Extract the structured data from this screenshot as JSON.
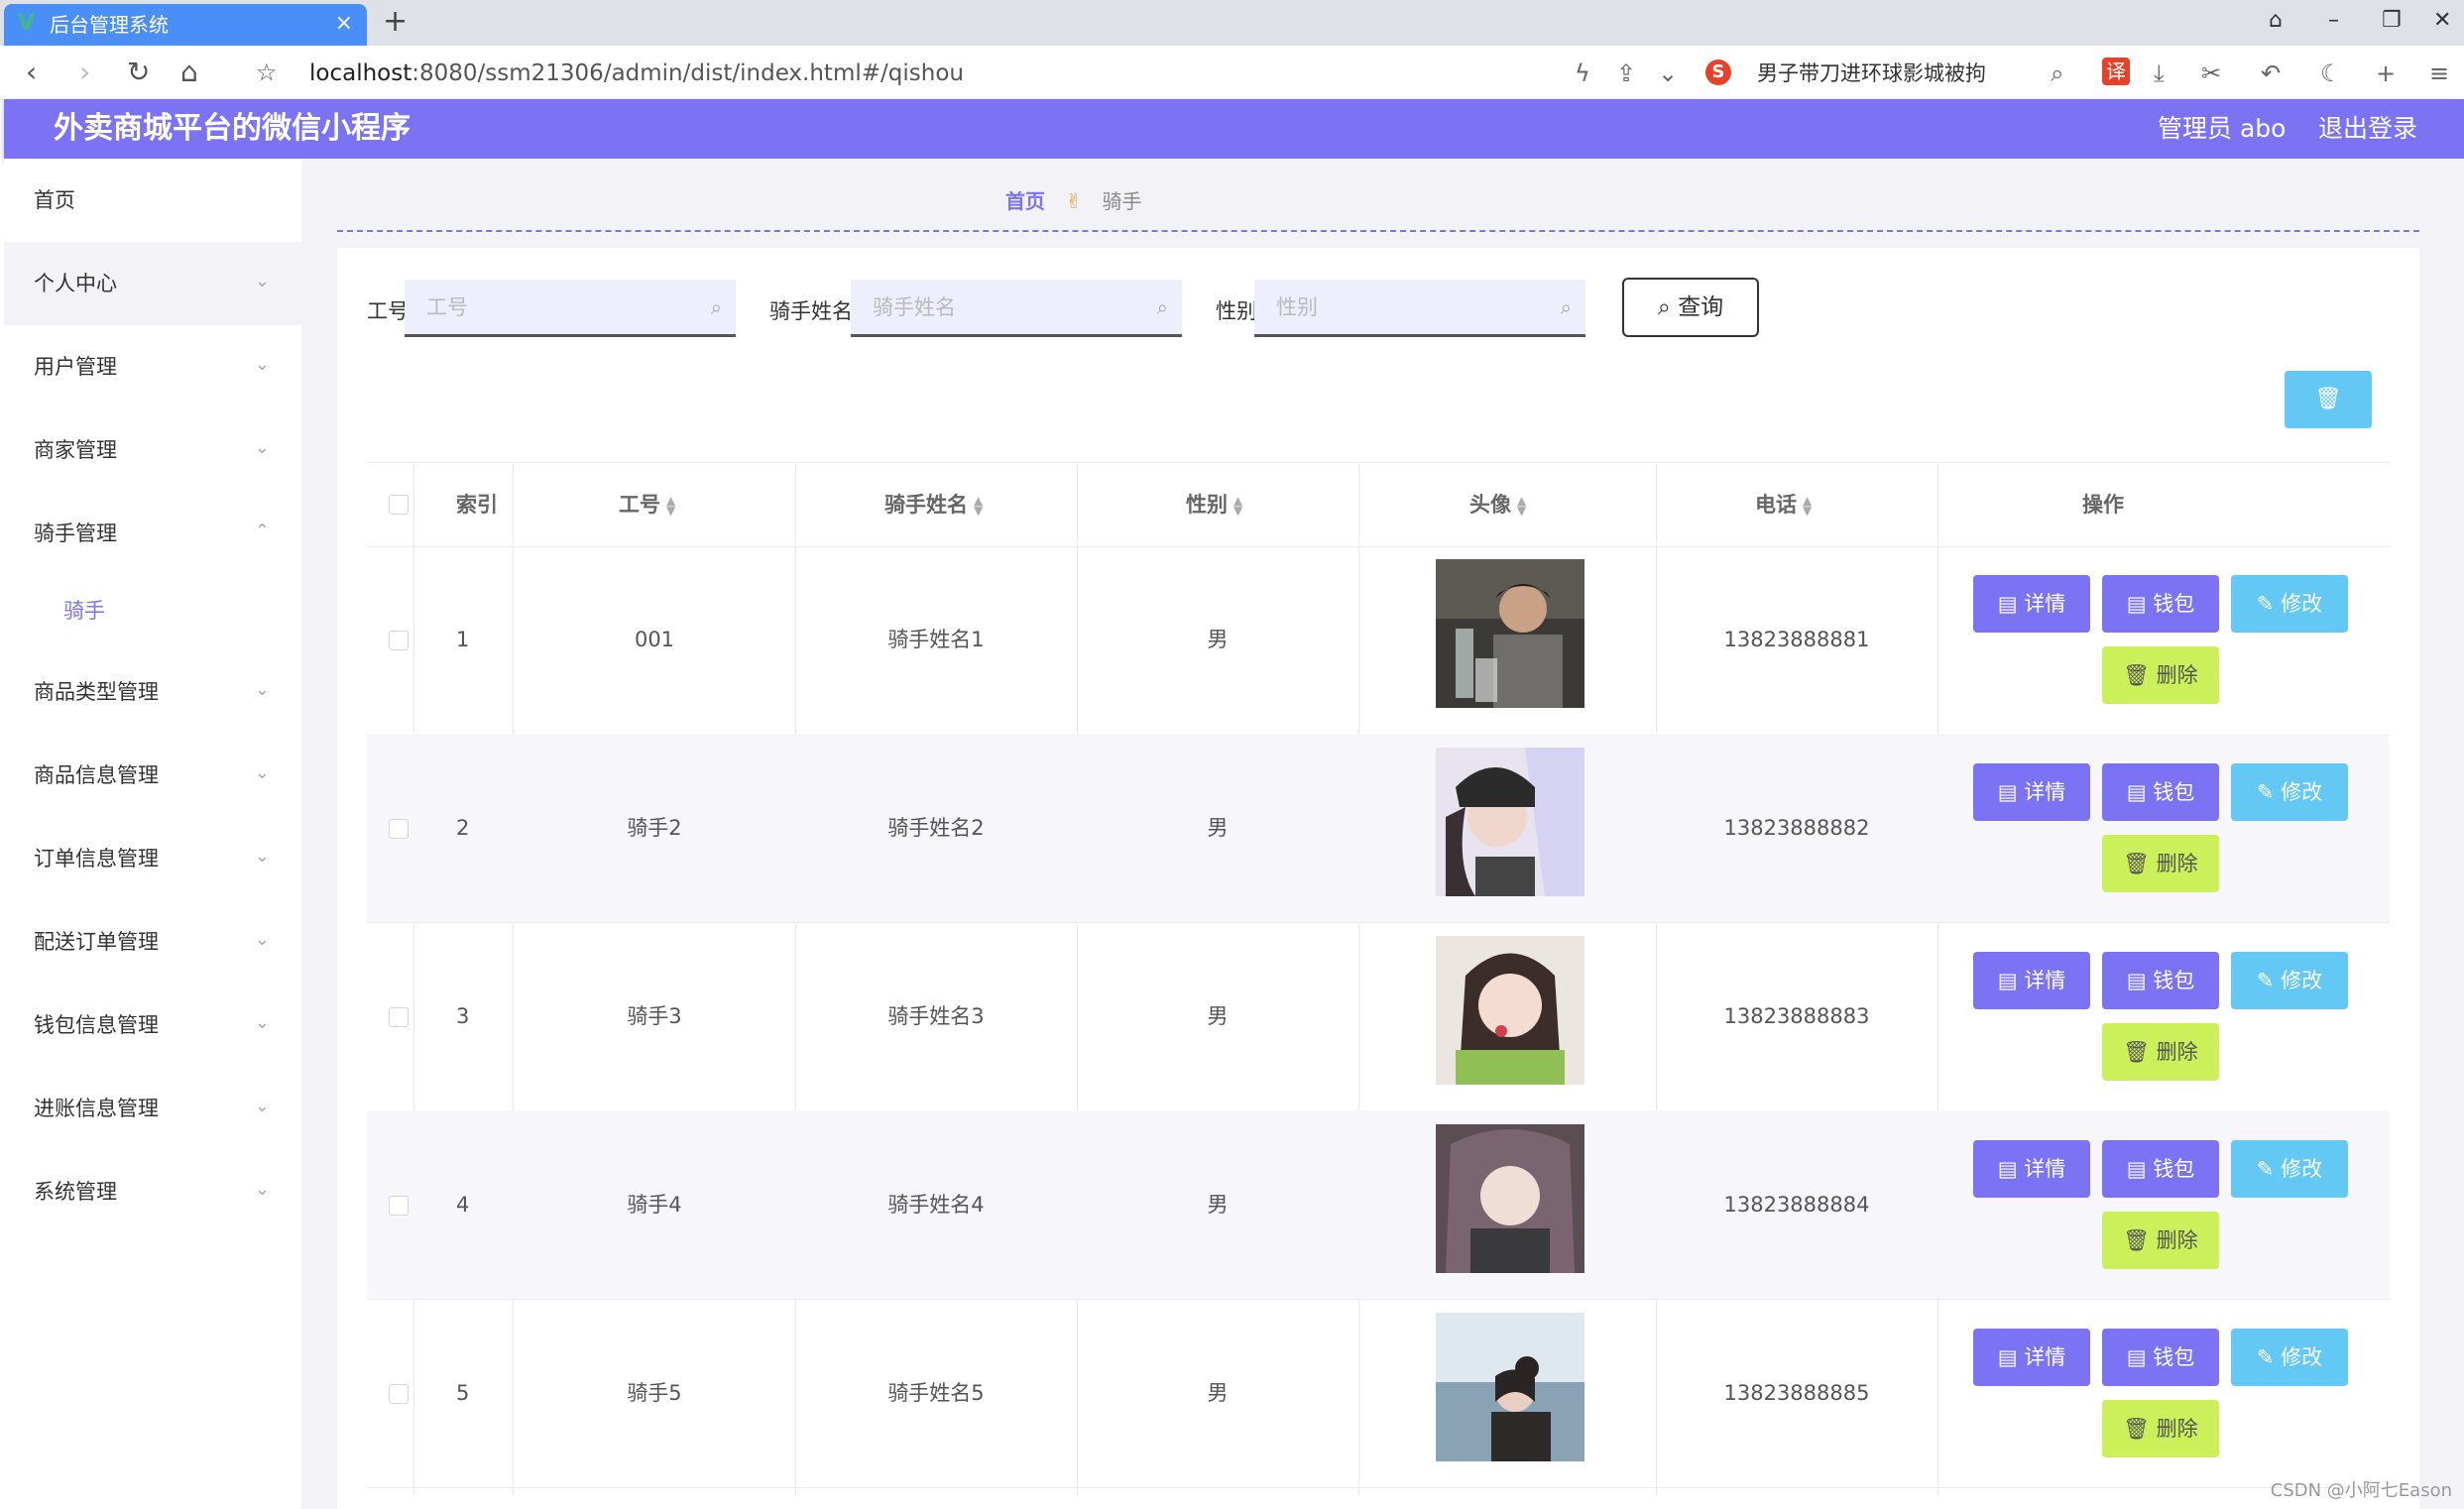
{
  "browser": {
    "tab_title": "后台管理系统",
    "url_host": "localhost",
    "url_path": ":8080/ssm21306/admin/dist/index.html#/qishou",
    "search_suggestion": "男子带刀进环球影城被拘"
  },
  "header": {
    "title": "外卖商城平台的微信小程序",
    "admin": "管理员 abo",
    "logout": "退出登录"
  },
  "sidebar": {
    "items": [
      {
        "label": "首页"
      },
      {
        "label": "个人中心"
      },
      {
        "label": "用户管理"
      },
      {
        "label": "商家管理"
      },
      {
        "label": "骑手管理"
      },
      {
        "label": "商品类型管理"
      },
      {
        "label": "商品信息管理"
      },
      {
        "label": "订单信息管理"
      },
      {
        "label": "配送订单管理"
      },
      {
        "label": "钱包信息管理"
      },
      {
        "label": "进账信息管理"
      },
      {
        "label": "系统管理"
      }
    ],
    "sub_item": "骑手"
  },
  "breadcrumb": {
    "home": "首页",
    "current": "骑手"
  },
  "search": {
    "label_gonghao": "工号",
    "ph_gonghao": "工号",
    "label_name": "骑手姓名",
    "ph_name": "骑手姓名",
    "label_gender": "性别",
    "ph_gender": "性别",
    "query": "查询"
  },
  "table": {
    "headers": [
      "索引",
      "工号",
      "骑手姓名",
      "性别",
      "头像",
      "电话",
      "操作"
    ],
    "rows": [
      {
        "index": "1",
        "gonghao": "001",
        "name": "骑手姓名1",
        "gender": "男",
        "phone": "13823888881"
      },
      {
        "index": "2",
        "gonghao": "骑手2",
        "name": "骑手姓名2",
        "gender": "男",
        "phone": "13823888882"
      },
      {
        "index": "3",
        "gonghao": "骑手3",
        "name": "骑手姓名3",
        "gender": "男",
        "phone": "13823888883"
      },
      {
        "index": "4",
        "gonghao": "骑手4",
        "name": "骑手姓名4",
        "gender": "男",
        "phone": "13823888884"
      },
      {
        "index": "5",
        "gonghao": "骑手5",
        "name": "骑手姓名5",
        "gender": "男",
        "phone": "13823888885"
      }
    ],
    "actions": {
      "detail": "详情",
      "wallet": "钱包",
      "edit": "修改",
      "delete": "删除"
    }
  },
  "watermark": "CSDN @小阿七Eason",
  "colors": {
    "primary": "#7b73f4",
    "info": "#63c8f3",
    "lime": "#ccf05a"
  }
}
